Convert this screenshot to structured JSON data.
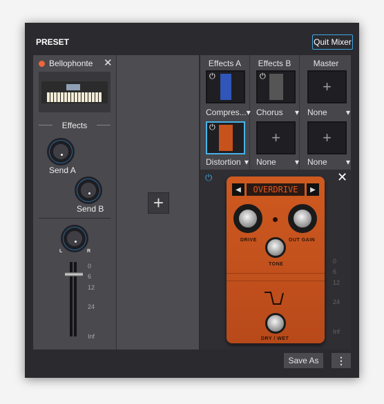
{
  "header": {
    "title": "PRESET",
    "quit_label": "Quit Mixer"
  },
  "channel": {
    "name": "Bellophonte",
    "effects_label": "Effects",
    "send_a": "Send A",
    "send_b": "Send B",
    "pan_l": "L",
    "pan_r": "R",
    "fader_ticks": [
      "0",
      "6",
      "12",
      "24",
      "Inf"
    ],
    "fader_value": "6"
  },
  "fx": {
    "columns": [
      {
        "title": "Effects A",
        "slots": [
          {
            "name": "Compres...",
            "filled": true,
            "color": "#2f56b8"
          },
          {
            "name": "Distortion",
            "filled": true,
            "color": "#c8521c",
            "selected": true
          }
        ]
      },
      {
        "title": "Effects B",
        "slots": [
          {
            "name": "Chorus",
            "filled": true,
            "color": "#555555"
          },
          {
            "name": "None",
            "filled": false
          }
        ]
      },
      {
        "title": "Master",
        "slots": [
          {
            "name": "None",
            "filled": false
          },
          {
            "name": "None",
            "filled": false
          }
        ]
      }
    ]
  },
  "editor": {
    "mode": "OVERDRIVE",
    "drive": "DRIVE",
    "out_gain": "OUT GAIN",
    "tone": "TONE",
    "drywet": "DRY / WET",
    "ticks": [
      "0",
      "6",
      "12",
      "24",
      "Inf"
    ]
  },
  "footer": {
    "save_as": "Save As",
    "more": "⋮"
  },
  "colors": {
    "accent": "#3fa9e6",
    "pedal": "#c8521c",
    "record": "#f0643a"
  }
}
